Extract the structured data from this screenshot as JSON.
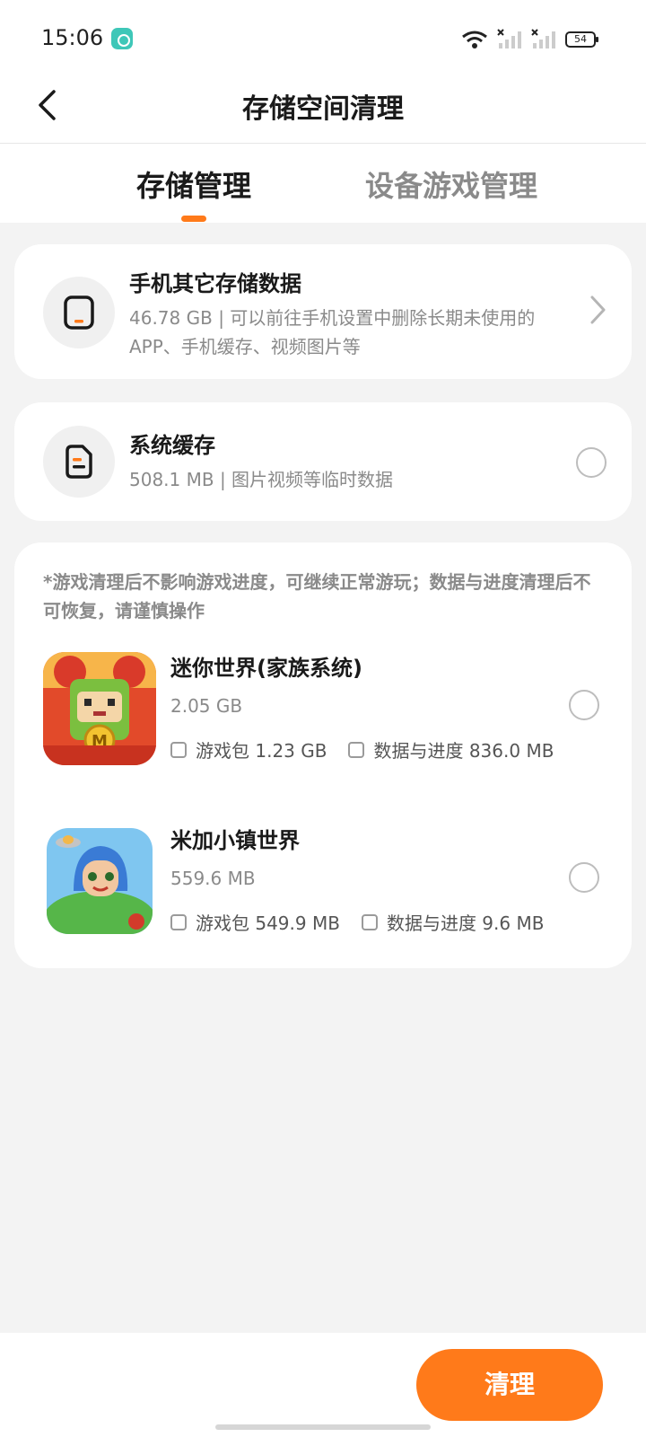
{
  "status_bar": {
    "time": "15:06",
    "battery": "54"
  },
  "header": {
    "title": "存储空间清理",
    "back_icon": "chevron-left-icon"
  },
  "tabs": [
    {
      "label": "存储管理",
      "active": true
    },
    {
      "label": "设备游戏管理",
      "active": false
    }
  ],
  "storage_items": [
    {
      "title": "手机其它存储数据",
      "description": "46.78 GB | 可以前往手机设置中删除长期未使用的APP、手机缓存、视频图片等",
      "icon": "phone-icon"
    },
    {
      "title": "系统缓存",
      "description": "508.1 MB | 图片视频等临时数据",
      "icon": "document-icon"
    }
  ],
  "games_section": {
    "notice": "*游戏清理后不影响游戏进度，可继续正常游玩；数据与进度清理后不可恢复，请谨慎操作",
    "games": [
      {
        "name": "迷你世界(家族系统)",
        "size": "2.05 GB",
        "package_label": "游戏包 1.23 GB",
        "data_label": "数据与进度 836.0 MB"
      },
      {
        "name": "米加小镇世界",
        "size": "559.6 MB",
        "package_label": "游戏包 549.9 MB",
        "data_label": "数据与进度 9.6 MB"
      }
    ]
  },
  "footer": {
    "clean_button": "清理"
  },
  "colors": {
    "accent": "#ff7a1a",
    "background": "#f3f3f3",
    "muted_text": "#8a8a8a"
  }
}
